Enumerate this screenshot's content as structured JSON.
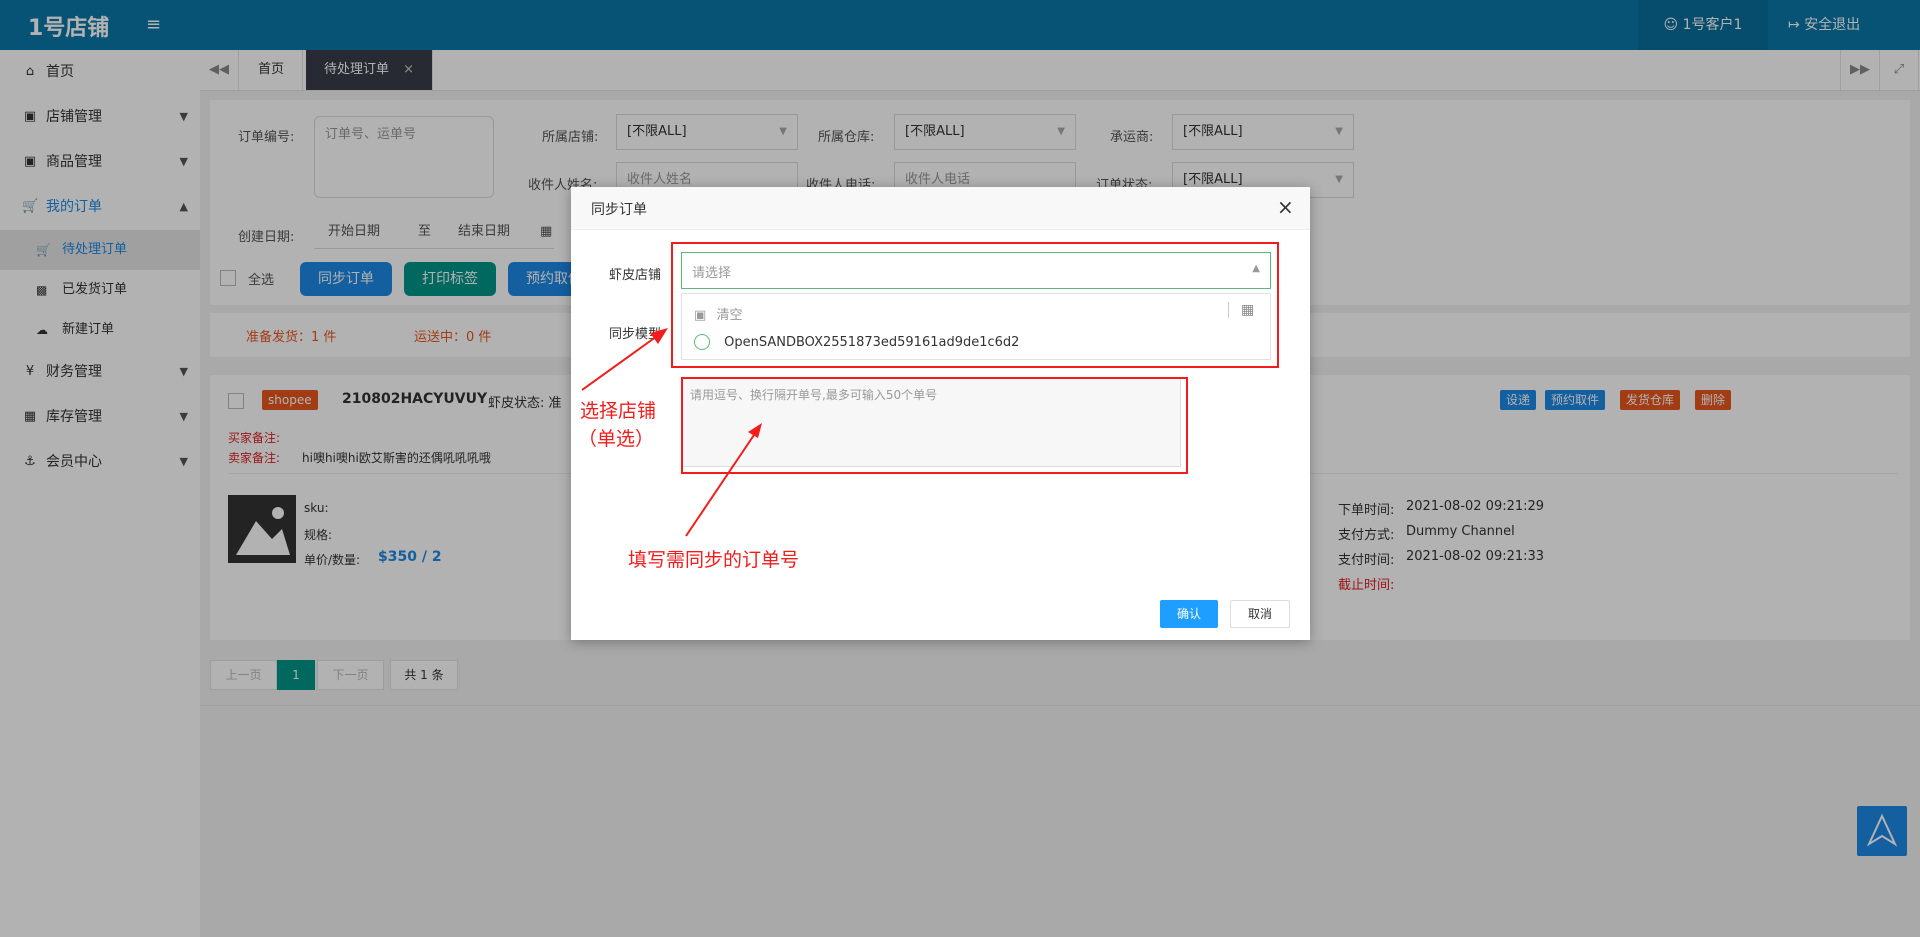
{
  "header": {
    "logo": "1号店铺",
    "user": "1号客户1",
    "logout": "安全退出"
  },
  "sidebar": {
    "items": [
      {
        "label": "首页",
        "icon": "home-icon"
      },
      {
        "label": "店铺管理",
        "icon": "shop-icon"
      },
      {
        "label": "商品管理",
        "icon": "goods-icon"
      },
      {
        "label": "我的订单",
        "icon": "cart-icon"
      },
      {
        "label": "待处理订单",
        "icon": "cart-icon"
      },
      {
        "label": "已发货订单",
        "icon": "truck-icon"
      },
      {
        "label": "新建订单",
        "icon": "cloud-upload-icon"
      },
      {
        "label": "财务管理",
        "icon": "yen-icon"
      },
      {
        "label": "库存管理",
        "icon": "table-icon"
      },
      {
        "label": "会员中心",
        "icon": "anchor-icon"
      }
    ]
  },
  "tabs": [
    {
      "label": "首页"
    },
    {
      "label": "待处理订单"
    }
  ],
  "filters": {
    "order_no_label": "订单编号:",
    "order_no_placeholder": "订单号、运单号",
    "shop_label": "所属店铺:",
    "shop_value": "[不限ALL]",
    "warehouse_label": "所属仓库:",
    "warehouse_value": "[不限ALL]",
    "carrier_label": "承运商:",
    "carrier_value": "[不限ALL]",
    "recipient_label": "收件人姓名:",
    "recipient_placeholder": "收件人姓名",
    "phone_label": "收件人电话:",
    "phone_placeholder": "收件人电话",
    "status_label": "订单状态:",
    "status_value": "[不限ALL]",
    "date_label": "创建日期:",
    "date_start": "开始日期",
    "date_to": "至",
    "date_end": "结束日期"
  },
  "actions": {
    "select_all": "全选",
    "sync": "同步订单",
    "print": "打印标签",
    "reserve": "预约取件"
  },
  "stats": {
    "ready": "准备发货：1 件",
    "shipping": "运送中：0 件"
  },
  "order": {
    "platform": "shopee",
    "order_no": "210802HACYUVUY",
    "status_label": "虾皮状态: 准",
    "buyer_note_label": "买家备注:",
    "seller_note_label": "卖家备注:",
    "seller_note": "hi噢hi噢hi欧艾斯害的还偶吼吼吼哦",
    "sku_label": "sku:",
    "spec_label": "规格:",
    "price_label": "单价/数量:",
    "price": "$350 / 2",
    "order_time_label": "下单时间:",
    "order_time": "2021-08-02 09:21:29",
    "pay_method_label": "支付方式:",
    "pay_method": "Dummy Channel",
    "pay_time_label": "支付时间:",
    "pay_time": "2021-08-02 09:21:33",
    "deadline_label": "截止时间:",
    "btn_ship": "设递",
    "btn_reserve": "预约取件",
    "btn_warehouse": "发货仓库",
    "btn_delete": "删除"
  },
  "pagination": {
    "prev": "上一页",
    "current": "1",
    "next": "下一页",
    "total": "共 1 条"
  },
  "modal": {
    "title": "同步订单",
    "shop_label": "虾皮店铺",
    "shop_placeholder": "请选择",
    "clear": "清空",
    "option": "OpenSANDBOX2551873ed59161ad9de1c6d2",
    "model_label": "同步模型",
    "textarea_placeholder": "请用逗号、换行隔开单号,最多可输入50个单号",
    "confirm": "确认",
    "cancel": "取消"
  },
  "annotations": {
    "select_shop": "选择店铺",
    "single": "（单选）",
    "fill_orders": "填写需同步的订单号"
  },
  "colors": {
    "header": "#0a78a9",
    "primary": "#1e88e5",
    "green": "#009688",
    "orange": "#e8571e",
    "annotation": "#f21c1c"
  }
}
